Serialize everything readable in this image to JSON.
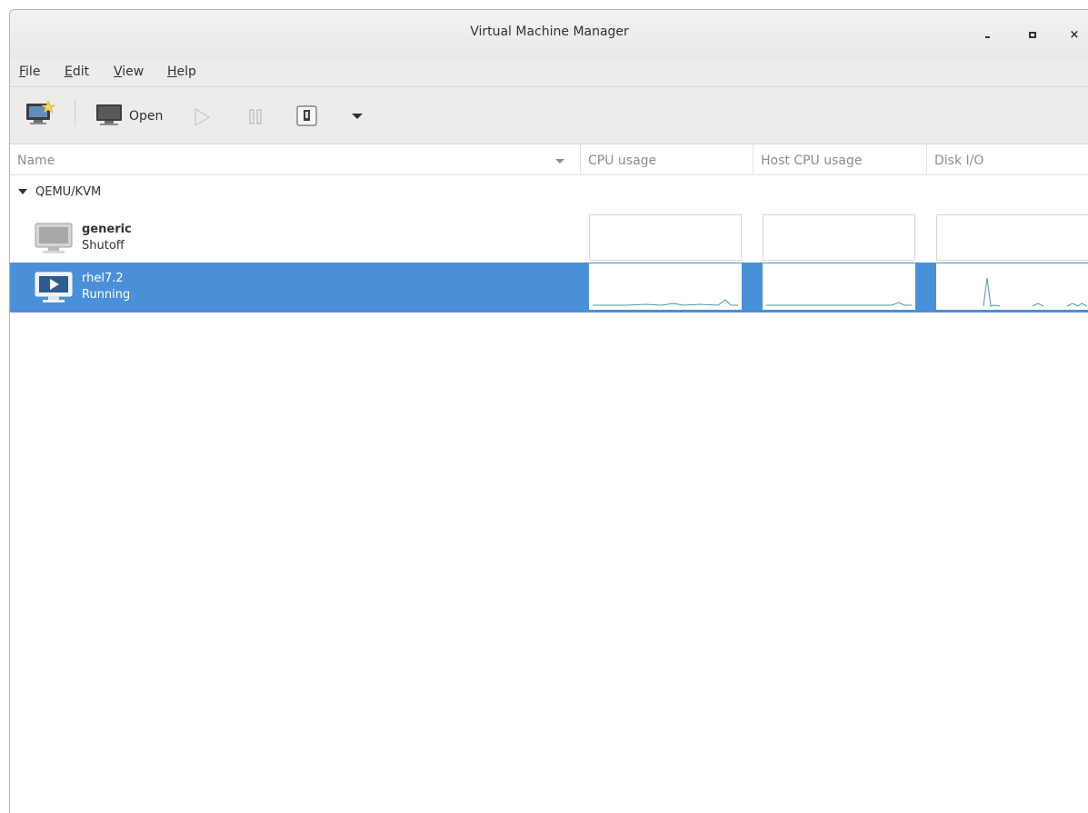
{
  "window": {
    "title": "Virtual Machine Manager",
    "close_glyph": "×"
  },
  "menubar": {
    "file": {
      "accel": "F",
      "rest": "ile"
    },
    "edit": {
      "accel": "E",
      "rest": "dit"
    },
    "view": {
      "accel": "V",
      "rest": "iew"
    },
    "help": {
      "accel": "H",
      "rest": "elp"
    }
  },
  "toolbar": {
    "new_vm_icon": "new-vm-icon",
    "open_label": "Open",
    "run_icon": "play-icon",
    "pause_icon": "pause-icon",
    "shutdown_icon": "shutdown-icon",
    "menu_icon": "dropdown-arrow-icon"
  },
  "columns": [
    "Name",
    "CPU usage",
    "Host CPU usage",
    "Disk I/O"
  ],
  "group": {
    "label": "QEMU/KVM"
  },
  "vms": [
    {
      "name": "generic",
      "status": "Shutoff",
      "icon": "monitor-icon"
    },
    {
      "name": "rhel7.2",
      "status": "Running",
      "icon": "running-monitor-icon"
    }
  ],
  "colors": {
    "selection": "#4a90d9",
    "graph_line": "#4e9a9e"
  }
}
